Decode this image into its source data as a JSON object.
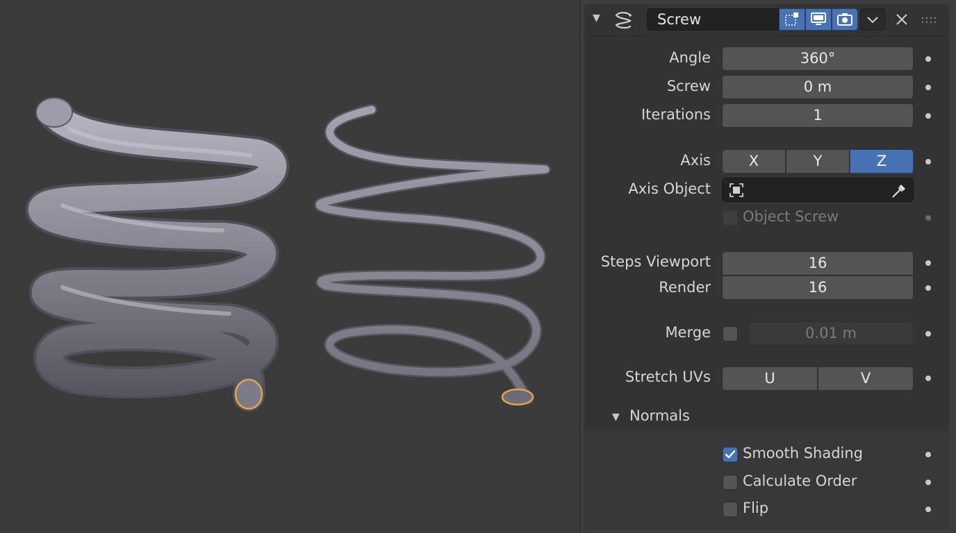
{
  "modifier": {
    "name": "Screw",
    "icon": "screw-modifier-icon",
    "header_icons": [
      "edit-mode-icon",
      "realtime-display-icon",
      "render-icon",
      "dropdown-icon",
      "close-icon"
    ]
  },
  "properties": {
    "angle": {
      "label": "Angle",
      "value": "360°"
    },
    "screw": {
      "label": "Screw",
      "value": "0 m"
    },
    "iterations": {
      "label": "Iterations",
      "value": "1"
    },
    "axis": {
      "label": "Axis",
      "options": [
        "X",
        "Y",
        "Z"
      ],
      "selected": "Z"
    },
    "axis_object": {
      "label": "Axis Object",
      "value": ""
    },
    "object_screw": {
      "label": "Object Screw",
      "checked": false
    },
    "steps_viewport": {
      "label": "Steps Viewport",
      "value": "16"
    },
    "render": {
      "label": "Render",
      "value": "16"
    },
    "merge": {
      "label": "Merge",
      "checked": false,
      "value": "0.01 m"
    },
    "stretch_uvs": {
      "label": "Stretch UVs",
      "options": [
        "U",
        "V"
      ]
    }
  },
  "normals": {
    "title": "Normals",
    "smooth_shading": {
      "label": "Smooth Shading",
      "checked": true
    },
    "calculate_order": {
      "label": "Calculate Order",
      "checked": false
    },
    "flip": {
      "label": "Flip",
      "checked": false
    }
  },
  "colors": {
    "accent": "#4772b3",
    "selection_outline": "#e8a24a",
    "mesh": "#8e8e98"
  }
}
